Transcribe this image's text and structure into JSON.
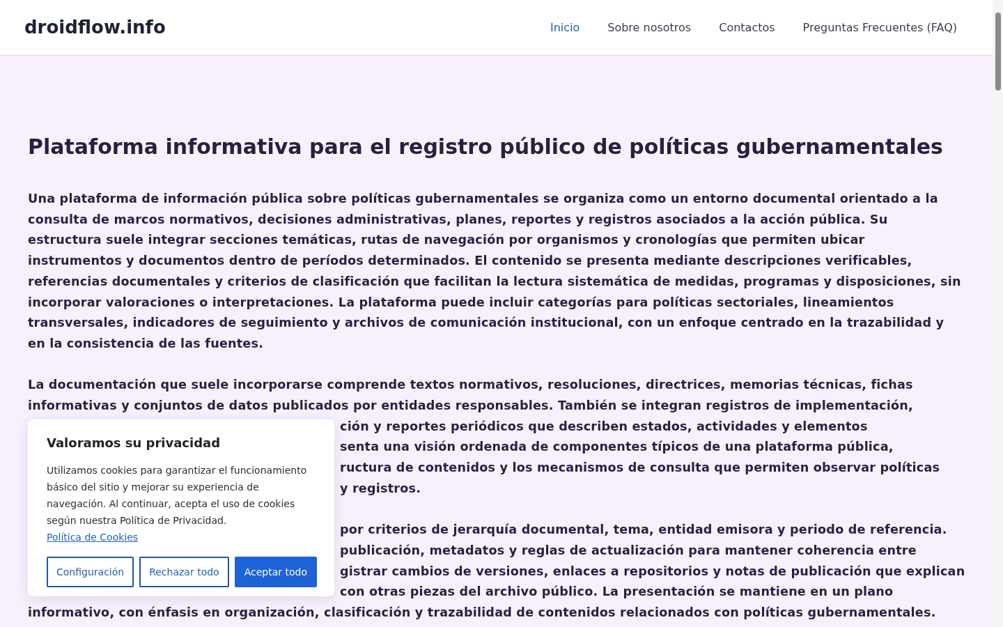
{
  "header": {
    "logo": "droidflow.info",
    "nav": [
      {
        "label": "Inicio",
        "selected": true
      },
      {
        "label": "Sobre nosotros",
        "selected": false
      },
      {
        "label": "Contactos",
        "selected": false
      },
      {
        "label": "Preguntas Frecuentes (FAQ)",
        "selected": false
      }
    ]
  },
  "main": {
    "title": "Plataforma informativa para el registro público de políticas gubernamentales",
    "paragraphs": [
      {
        "lines": [
          {
            "kind": "full",
            "text": "Una plataforma de información pública sobre políticas gubernamentales se organiza como un entorno documental orientado a la"
          },
          {
            "kind": "full",
            "text": "consulta de marcos normativos, decisiones administrativas, planes, reportes y registros asociados a la acción pública. Su"
          },
          {
            "kind": "full",
            "text": "estructura suele integrar secciones temáticas, rutas de navegación por organismos y cronologías que permiten ubicar"
          },
          {
            "kind": "full",
            "text": "instrumentos y documentos dentro de períodos determinados. El contenido se presenta mediante descripciones verificables,"
          },
          {
            "kind": "full",
            "text": "referencias documentales y criterios de clasificación que facilitan la lectura sistemática de medidas, programas y disposiciones, sin"
          },
          {
            "kind": "full",
            "text": "incorporar valoraciones o interpretaciones. La plataforma puede incluir categorías para políticas sectoriales, lineamientos"
          },
          {
            "kind": "full",
            "text": "transversales, indicadores de seguimiento y archivos de comunicación institucional, con un enfoque centrado en la trazabilidad y"
          },
          {
            "kind": "full",
            "text": "en la consistencia de las fuentes."
          }
        ]
      },
      {
        "lines": [
          {
            "kind": "full",
            "text": "La documentación que suele incorporarse comprende textos normativos, resoluciones, directrices, memorias técnicas, fichas"
          },
          {
            "kind": "full",
            "text": "informativas y conjuntos de datos publicados por entidades responsables. También se integran registros de implementación,"
          },
          {
            "kind": "partial",
            "text": "ción y reportes periódicos que describen estados, actividades y elementos"
          },
          {
            "kind": "partial",
            "text": "senta una visión ordenada de componentes típicos de una plataforma pública,"
          },
          {
            "kind": "partial",
            "text": "ructura de contenidos y los mecanismos de consulta que permiten observar políticas"
          },
          {
            "kind": "partial",
            "text": "y registros."
          }
        ]
      },
      {
        "lines": [
          {
            "kind": "partial",
            "text": "por criterios de jerarquía documental, tema, entidad emisora y periodo de referencia."
          },
          {
            "kind": "partial",
            "text": "publicación, metadatos y reglas de actualización para mantener coherencia entre"
          },
          {
            "kind": "partial",
            "text": "gistrar cambios de versiones, enlaces a repositorios y notas de publicación que explican"
          },
          {
            "kind": "partial",
            "text": "con otras piezas del archivo público. La presentación se mantiene en un plano"
          },
          {
            "kind": "full",
            "text": "informativo, con énfasis en organización, clasificación y trazabilidad de contenidos relacionados con políticas gubernamentales."
          }
        ]
      }
    ]
  },
  "cookie_banner": {
    "title": "Valoramos su privacidad",
    "text": "Utilizamos cookies para garantizar el funcionamiento básico del sitio y mejorar su experiencia de navegación. Al continuar, acepta el uso de cookies según nuestra Política de Privacidad.",
    "link": "Política de Cookies",
    "buttons": [
      {
        "label": "Configuración",
        "kind": "outline"
      },
      {
        "label": "Rechazar todo",
        "kind": "outline"
      },
      {
        "label": "Aceptar todo",
        "kind": "primary"
      }
    ]
  }
}
